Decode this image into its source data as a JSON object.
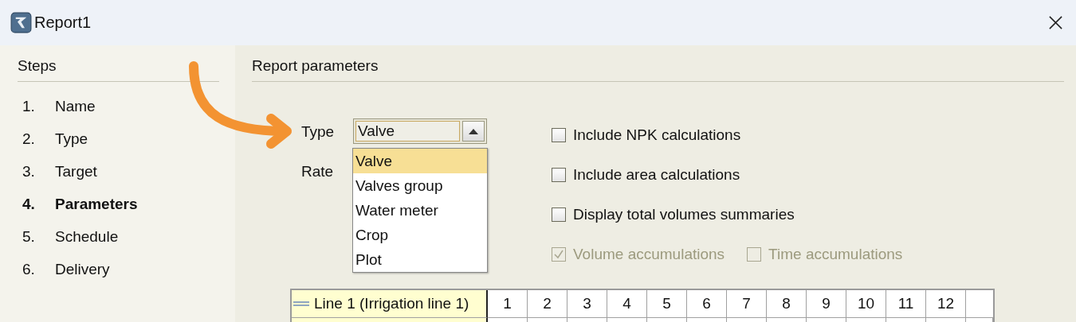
{
  "window": {
    "title": "Report1"
  },
  "steps": {
    "title": "Steps",
    "items": [
      {
        "number": "1.",
        "label": "Name",
        "selected": false
      },
      {
        "number": "2.",
        "label": "Type",
        "selected": false
      },
      {
        "number": "3.",
        "label": "Target",
        "selected": false
      },
      {
        "number": "4.",
        "label": "Parameters",
        "selected": true
      },
      {
        "number": "5.",
        "label": "Schedule",
        "selected": false
      },
      {
        "number": "6.",
        "label": "Delivery",
        "selected": false
      }
    ]
  },
  "parameters": {
    "title": "Report parameters",
    "type_field": {
      "label": "Type",
      "value": "Valve",
      "expanded": true
    },
    "type_options": [
      {
        "label": "Valve",
        "selected": true
      },
      {
        "label": "Valves group",
        "selected": false
      },
      {
        "label": "Water meter",
        "selected": false
      },
      {
        "label": "Crop",
        "selected": false
      },
      {
        "label": "Plot",
        "selected": false
      }
    ],
    "rate_label": "Rate",
    "checkboxes": [
      {
        "label": "Include NPK calculations",
        "checked": false,
        "disabled": false
      },
      {
        "label": "Include area calculations",
        "checked": false,
        "disabled": false
      },
      {
        "label": "Display total volumes summaries",
        "checked": false,
        "disabled": false
      },
      {
        "label": "Volume accumulations",
        "checked": true,
        "disabled": true
      },
      {
        "label": "Time accumulations",
        "checked": false,
        "disabled": true
      }
    ],
    "table": {
      "columns": [
        "Line 1 (Irrigation line 1)",
        "1",
        "2",
        "3",
        "4",
        "5",
        "6",
        "7",
        "8",
        "9",
        "10",
        "11",
        "12"
      ]
    }
  }
}
